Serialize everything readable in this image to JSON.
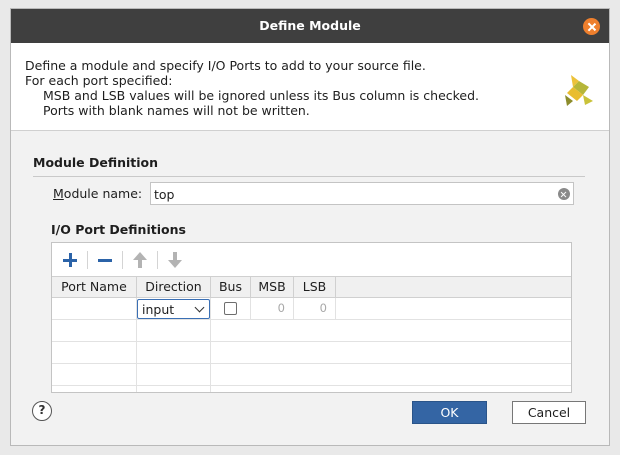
{
  "window": {
    "title": "Define Module"
  },
  "header": {
    "line1": "Define a module and specify I/O Ports to add to your source file.",
    "line2": "For each port specified:",
    "line3": "MSB and LSB values will be ignored unless its Bus column is checked.",
    "line4": "Ports with blank names will not be written."
  },
  "module": {
    "section_title": "Module Definition",
    "name_label_mnemonic": "M",
    "name_label_rest": "odule name:",
    "name_value": "top"
  },
  "ports": {
    "section_title": "I/O Port Definitions",
    "columns": [
      "Port Name",
      "Direction",
      "Bus",
      "MSB",
      "LSB"
    ],
    "rows": [
      {
        "port_name": "",
        "direction": "input",
        "bus": false,
        "msb": "0",
        "lsb": "0"
      }
    ]
  },
  "buttons": {
    "help": "?",
    "ok": "OK",
    "cancel": "Cancel"
  },
  "colors": {
    "accent": "#3465a4",
    "close": "#ee7f2d",
    "titlebar": "#3f3f3f"
  },
  "icons": [
    "close-icon",
    "vivado-logo",
    "clear-icon",
    "add-icon",
    "remove-icon",
    "move-up-icon",
    "move-down-icon",
    "chevron-down-icon",
    "help-icon"
  ]
}
